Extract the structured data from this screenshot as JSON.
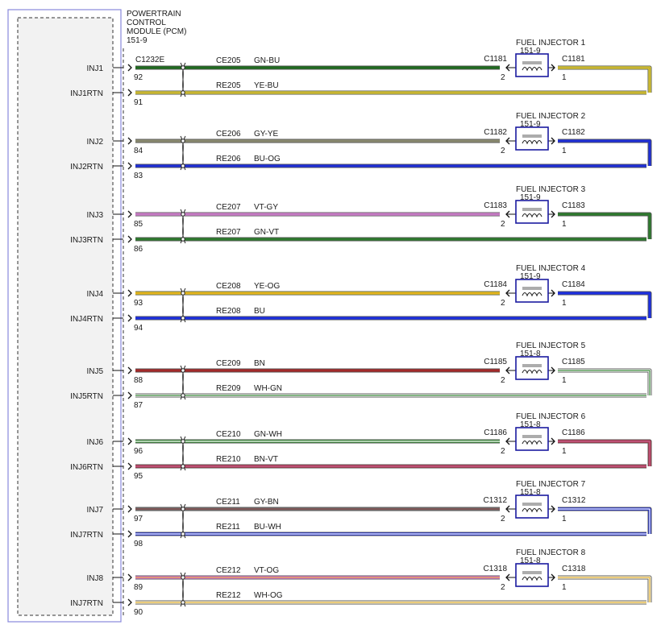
{
  "pcm": {
    "title_lines": [
      "POWERTRAIN",
      "CONTROL",
      "MODULE (PCM)",
      "151-9"
    ],
    "connector": "C1232E"
  },
  "circuits": [
    {
      "injector_name": "FUEL INJECTOR 1",
      "injector_ref": "151-9",
      "conn": "C1181",
      "sig_label": "INJ1",
      "rtn_label": "INJ1RTN",
      "sig_pin": "92",
      "rtn_pin": "91",
      "sig_circuit": "CE205",
      "sig_color": "GN-BU",
      "rtn_circuit": "RE205",
      "rtn_color": "YE-BU",
      "inj_sig_pin": "2",
      "inj_rtn_pin": "1",
      "sig_base": "#1f6b1f",
      "sig_stripe": "#1f6b1f",
      "rtn_base": "#e8df3a",
      "rtn_stripe": "#b89b2a",
      "loop_base": "#e8df3a",
      "loop_stripe": "#b89b2a"
    },
    {
      "injector_name": "FUEL INJECTOR 2",
      "injector_ref": "151-9",
      "conn": "C1182",
      "sig_label": "INJ2",
      "rtn_label": "INJ2RTN",
      "sig_pin": "84",
      "rtn_pin": "83",
      "sig_circuit": "CE206",
      "sig_color": "GY-YE",
      "rtn_circuit": "RE206",
      "rtn_color": "BU-OG",
      "inj_sig_pin": "2",
      "inj_rtn_pin": "1",
      "sig_base": "#8a8a70",
      "sig_stripe": "#8a8a70",
      "rtn_base": "#1f2fd6",
      "rtn_stripe": "#1f2fd6",
      "loop_base": "#1f2fd6",
      "loop_stripe": "#1f2fd6"
    },
    {
      "injector_name": "FUEL INJECTOR 3",
      "injector_ref": "151-9",
      "conn": "C1183",
      "sig_label": "INJ3",
      "rtn_label": "INJ3RTN",
      "sig_pin": "85",
      "rtn_pin": "86",
      "sig_circuit": "CE207",
      "sig_color": "VT-GY",
      "rtn_circuit": "RE207",
      "rtn_color": "GN-VT",
      "inj_sig_pin": "2",
      "inj_rtn_pin": "1",
      "sig_base": "#e58be0",
      "sig_stripe": "#b070b0",
      "rtn_base": "#2e7a2e",
      "rtn_stripe": "#2e7a2e",
      "loop_base": "#2e7a2e",
      "loop_stripe": "#2e7a2e"
    },
    {
      "injector_name": "FUEL INJECTOR 4",
      "injector_ref": "151-9",
      "conn": "C1184",
      "sig_label": "INJ4",
      "rtn_label": "INJ4RTN",
      "sig_pin": "93",
      "rtn_pin": "94",
      "sig_circuit": "CE208",
      "sig_color": "YE-OG",
      "rtn_circuit": "RE208",
      "rtn_color": "BU",
      "inj_sig_pin": "2",
      "inj_rtn_pin": "1",
      "sig_base": "#ecd21c",
      "sig_stripe": "#e0a020",
      "rtn_base": "#1c2fe0",
      "rtn_stripe": "#1c2fe0",
      "loop_base": "#1c2fe0",
      "loop_stripe": "#1c2fe0"
    },
    {
      "injector_name": "FUEL INJECTOR 5",
      "injector_ref": "151-8",
      "conn": "C1185",
      "sig_label": "INJ5",
      "rtn_label": "INJ5RTN",
      "sig_pin": "88",
      "rtn_pin": "87",
      "sig_circuit": "CE209",
      "sig_color": "BN",
      "rtn_circuit": "RE209",
      "rtn_color": "WH-GN",
      "inj_sig_pin": "2",
      "inj_rtn_pin": "1",
      "sig_base": "#a32a2a",
      "sig_stripe": "#a32a2a",
      "rtn_base": "#ffffff",
      "rtn_stripe": "#3a8a3a",
      "loop_base": "#ffffff",
      "loop_stripe": "#3a8a3a"
    },
    {
      "injector_name": "FUEL INJECTOR 6",
      "injector_ref": "151-8",
      "conn": "C1186",
      "sig_label": "INJ6",
      "rtn_label": "INJ6RTN",
      "sig_pin": "96",
      "rtn_pin": "95",
      "sig_circuit": "CE210",
      "sig_color": "GN-WH",
      "rtn_circuit": "RE210",
      "rtn_color": "BN-VT",
      "inj_sig_pin": "2",
      "inj_rtn_pin": "1",
      "sig_base": "#2e8a2e",
      "sig_stripe": "#ffffff",
      "rtn_base": "#b8344a",
      "rtn_stripe": "#c06090",
      "loop_base": "#b8344a",
      "loop_stripe": "#c06090"
    },
    {
      "injector_name": "FUEL INJECTOR 7",
      "injector_ref": "151-8",
      "conn": "C1312",
      "sig_label": "INJ7",
      "rtn_label": "INJ7RTN",
      "sig_pin": "97",
      "rtn_pin": "98",
      "sig_circuit": "CE211",
      "sig_color": "GY-BN",
      "rtn_circuit": "RE211",
      "rtn_color": "BU-WH",
      "inj_sig_pin": "2",
      "inj_rtn_pin": "1",
      "sig_base": "#707070",
      "sig_stripe": "#8a4a4a",
      "rtn_base": "#1f2fd6",
      "rtn_stripe": "#ffffff",
      "loop_base": "#1f2fd6",
      "loop_stripe": "#ffffff"
    },
    {
      "injector_name": "FUEL INJECTOR 8",
      "injector_ref": "151-8",
      "conn": "C1318",
      "sig_label": "INJ8",
      "rtn_label": "INJ7RTN",
      "sig_pin": "89",
      "rtn_pin": "90",
      "sig_circuit": "CE212",
      "sig_color": "VT-OG",
      "rtn_circuit": "RE212",
      "rtn_color": "WH-OG",
      "inj_sig_pin": "2",
      "inj_rtn_pin": "1",
      "sig_base": "#e07ae0",
      "sig_stripe": "#e0a040",
      "rtn_base": "#fffbe0",
      "rtn_stripe": "#e0b040",
      "loop_base": "#fffbe0",
      "loop_stripe": "#e0b040"
    }
  ],
  "colors": {
    "module_border": "#8888dd",
    "module_fill": "#f2f2f2",
    "injector_border": "#1a1aa0"
  }
}
